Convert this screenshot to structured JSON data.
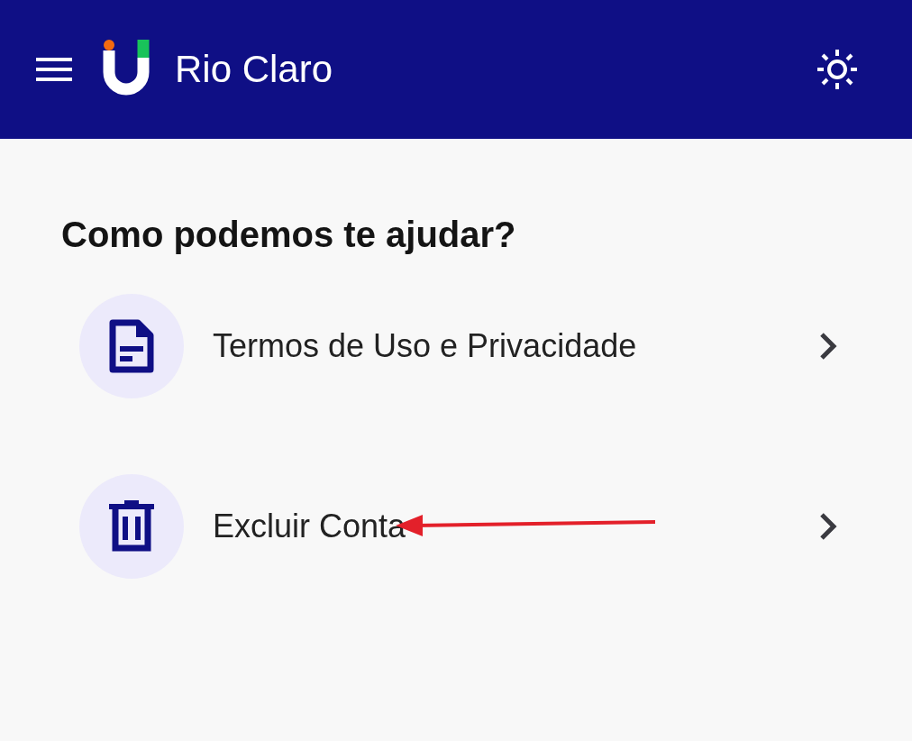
{
  "app_bar": {
    "title": "Rio Claro"
  },
  "heading": "Como podemos te ajudar?",
  "items": [
    {
      "kind": "document",
      "label": "Termos de Uso e Privacidade",
      "marked": false
    },
    {
      "kind": "trash",
      "label": "Excluir Conta",
      "marked": true
    }
  ]
}
